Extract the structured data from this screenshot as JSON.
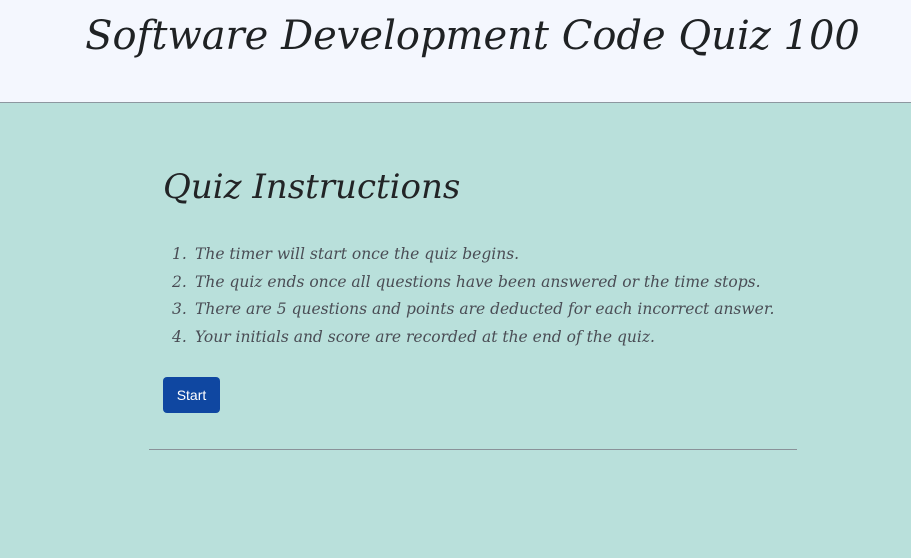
{
  "header": {
    "title": "Software Development Code Quiz 100"
  },
  "instructions": {
    "heading": "Quiz Instructions",
    "items": [
      {
        "number": "1.",
        "text": "The timer will start once the quiz begins."
      },
      {
        "number": "2.",
        "text": "The quiz ends once all questions have been answered or the time stops."
      },
      {
        "number": "3.",
        "text": "There are 5 questions and points are deducted for each incorrect answer."
      },
      {
        "number": "4.",
        "text": "Your initials and score are recorded at the end of the quiz."
      }
    ],
    "start_label": "Start"
  },
  "colors": {
    "header_background": "#f4f7fe",
    "page_background": "#b9e0db",
    "button_background": "#0f47a1"
  }
}
